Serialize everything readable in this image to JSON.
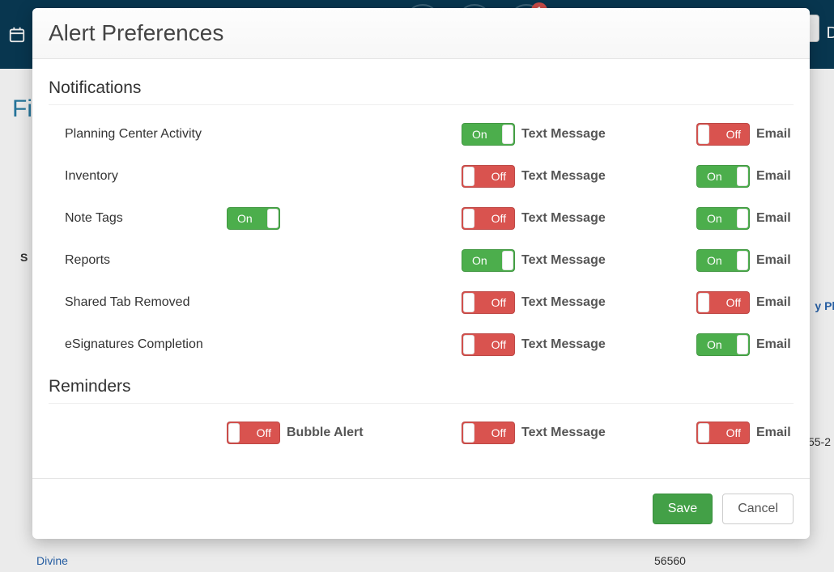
{
  "background": {
    "badge_count": "1",
    "title_fragment": "Fi",
    "letter_right": "D",
    "link_bottom": "Divine",
    "link_right": "y Ph",
    "cell_1": "55-2",
    "cell_2": "56560",
    "side_letter": "S"
  },
  "modal": {
    "title": "Alert Preferences",
    "sections": {
      "notifications_title": "Notifications",
      "reminders_title": "Reminders"
    },
    "labels": {
      "text_message": "Text Message",
      "email": "Email",
      "bubble_alert": "Bubble Alert",
      "on": "On",
      "off": "Off"
    },
    "notification_rows": [
      {
        "label": "Planning Center Activity",
        "extra_toggle": null,
        "text_message": true,
        "email": false
      },
      {
        "label": "Inventory",
        "extra_toggle": null,
        "text_message": false,
        "email": true
      },
      {
        "label": "Note Tags",
        "extra_toggle": true,
        "text_message": false,
        "email": true
      },
      {
        "label": "Reports",
        "extra_toggle": null,
        "text_message": true,
        "email": true
      },
      {
        "label": "Shared Tab Removed",
        "extra_toggle": null,
        "text_message": false,
        "email": false
      },
      {
        "label": "eSignatures Completion",
        "extra_toggle": null,
        "text_message": false,
        "email": true
      }
    ],
    "reminder_row": {
      "bubble_alert": false,
      "text_message": false,
      "email": false
    },
    "footer": {
      "save": "Save",
      "cancel": "Cancel"
    }
  }
}
